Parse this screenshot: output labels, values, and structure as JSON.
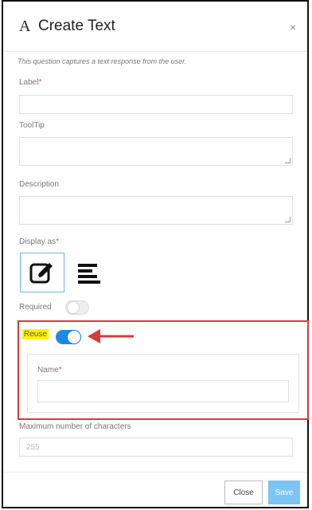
{
  "dialog": {
    "title_icon": "A",
    "title": "Create Text",
    "close_glyph": "×",
    "intro": "This question captures a text response from the user."
  },
  "fields": {
    "label": {
      "label": "Label",
      "required_mark": "*"
    },
    "tooltip": {
      "label": "ToolTip"
    },
    "description": {
      "label": "Description"
    },
    "display_as": {
      "label": "Display as",
      "required_mark": "*",
      "options": [
        "edit-icon",
        "align-left-icon"
      ]
    },
    "required": {
      "label": "Required",
      "on": false
    },
    "reuse": {
      "label": "Reuse",
      "on": true
    },
    "name": {
      "label": "Name",
      "required_mark": "*"
    },
    "max_chars": {
      "label": "Maximum number of characters",
      "placeholder": "255"
    }
  },
  "footer": {
    "close_label": "Close",
    "save_label": "Save"
  },
  "colors": {
    "accent": "#1e88e5",
    "highlight_border": "#d23c3c",
    "highlight_fill": "#fff300",
    "arrow": "#d23c3c",
    "save_bg": "#7dc3f4"
  }
}
